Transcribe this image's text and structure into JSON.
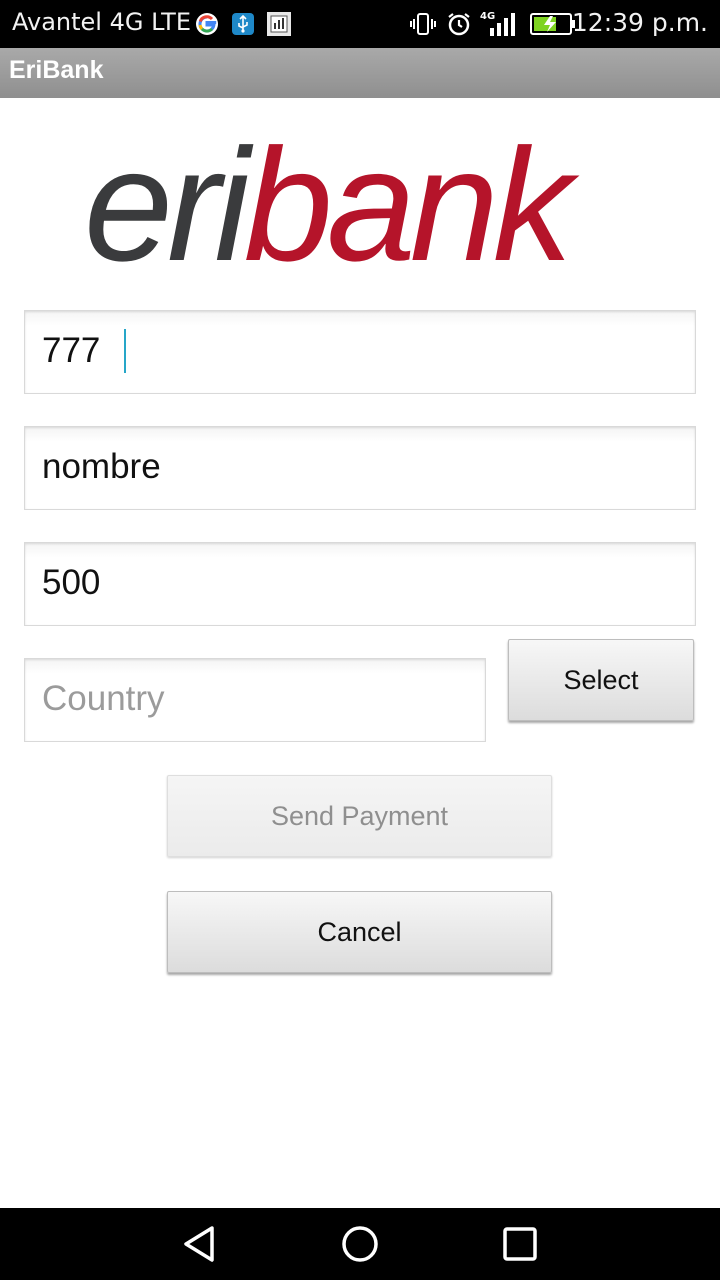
{
  "status_bar": {
    "carrier": "Avantel 4G LTE",
    "network_label": "4G",
    "time": "12:39 p.m."
  },
  "app": {
    "title": "EriBank"
  },
  "logo": {
    "part1": "eri",
    "part2": "bank",
    "color_dark": "#3a3b3d",
    "color_brand": "#b5142a"
  },
  "form": {
    "field1_value": "777",
    "field2_value": "nombre",
    "field3_value": "500",
    "country_placeholder": "Country",
    "select_label": "Select",
    "send_label": "Send Payment",
    "cancel_label": "Cancel"
  },
  "icons": {
    "status": [
      "google-icon",
      "usb-icon",
      "sim-icon",
      "vibrate-icon",
      "alarm-icon",
      "signal-icon",
      "battery-charging-icon"
    ],
    "nav": [
      "back-icon",
      "home-icon",
      "recents-icon"
    ]
  }
}
